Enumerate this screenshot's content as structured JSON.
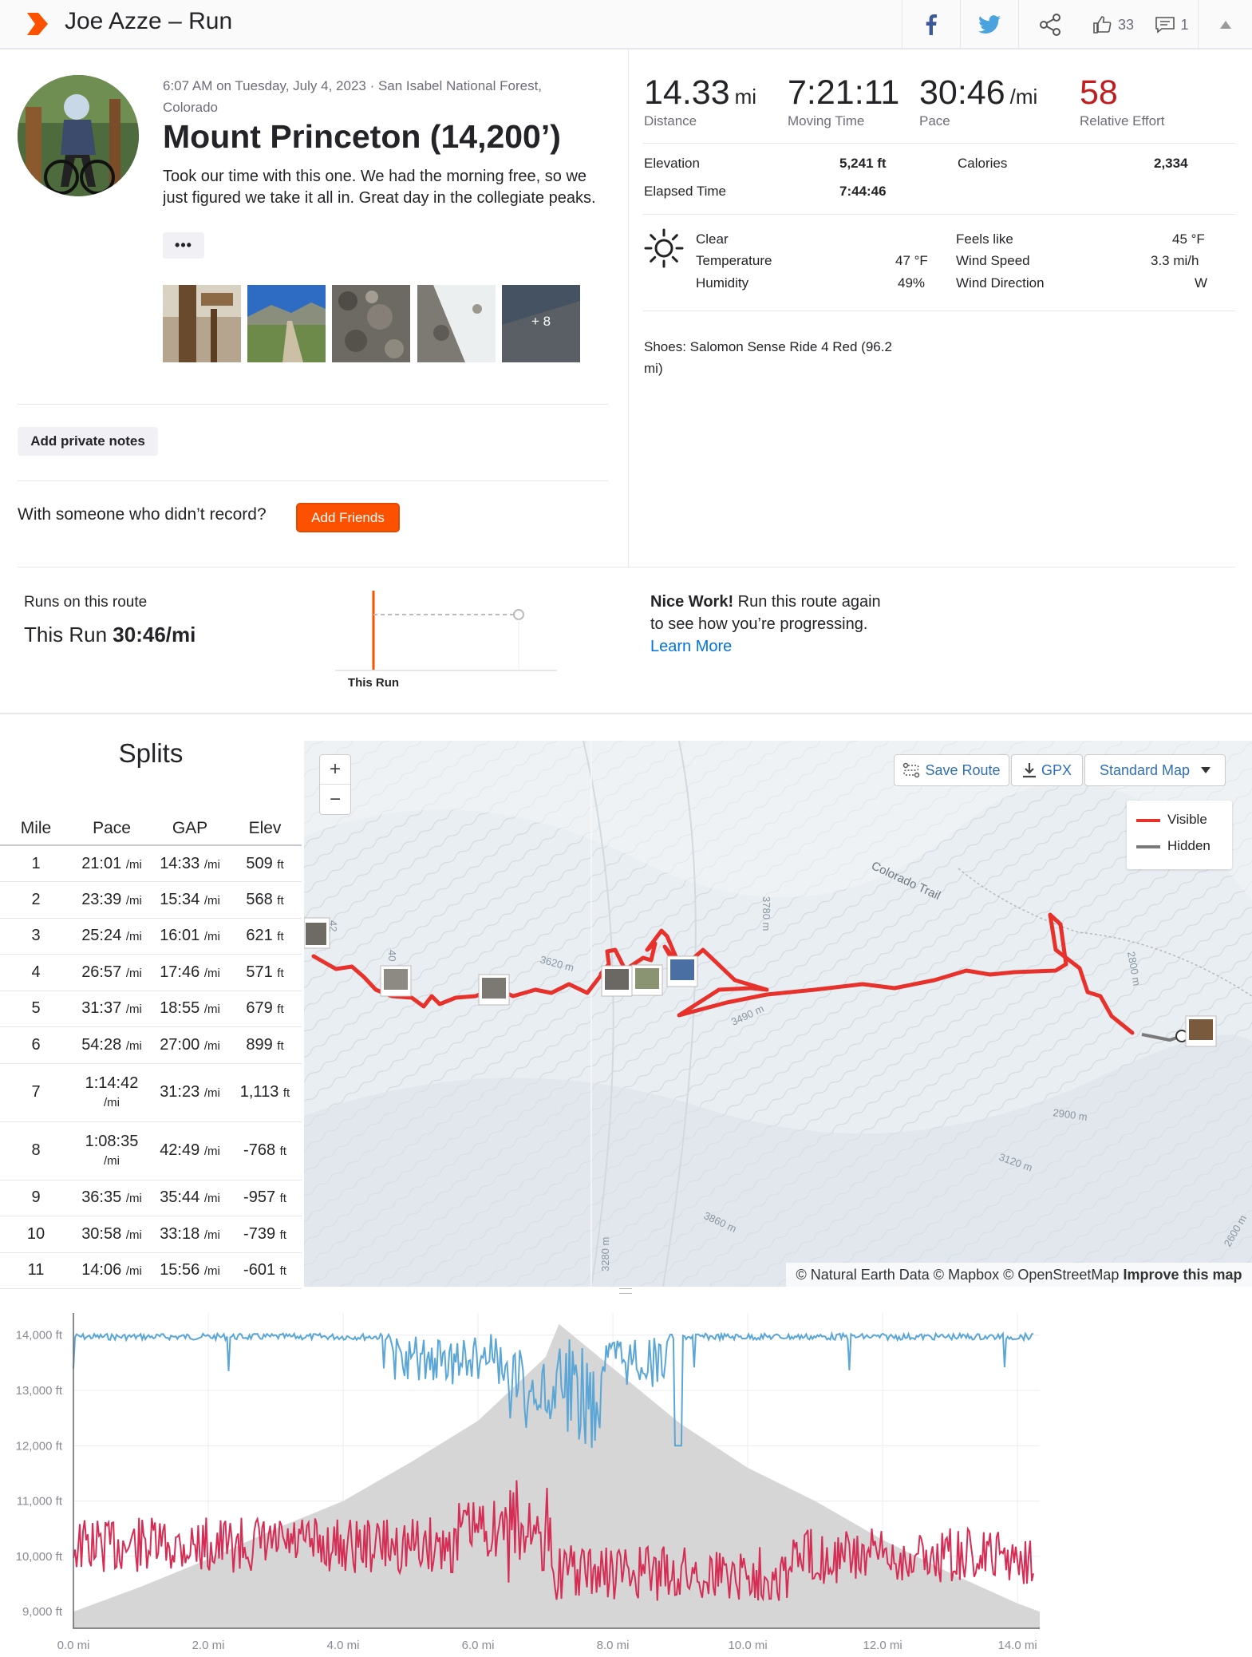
{
  "header": {
    "title": "Joe Azze – Run",
    "kudos_count": "33",
    "comments_count": "1"
  },
  "activity": {
    "meta_line1": "6:07 AM on Tuesday, July 4, 2023 · San Isabel National Forest,",
    "meta_line2": "Colorado",
    "title": "Mount Princeton (14,200’)",
    "description": "Took our time with this one. We had the morning free, so we just figured we take it all in. Great day in the collegiate peaks.",
    "more_label": "•••",
    "photos_more": "+ 8",
    "private_notes_label": "Add private notes",
    "with_someone_text": "With someone who didn’t record?",
    "add_friends_label": "Add Friends"
  },
  "stats": {
    "distance": {
      "value": "14.33",
      "unit": "mi",
      "label": "Distance"
    },
    "moving_time": {
      "value": "7:21:11",
      "label": "Moving Time"
    },
    "pace": {
      "value": "30:46",
      "unit": "/mi",
      "label": "Pace"
    },
    "relative_effort": {
      "value": "58",
      "label": "Relative Effort"
    },
    "elevation": {
      "label": "Elevation",
      "value": "5,241 ft"
    },
    "calories": {
      "label": "Calories",
      "value": "2,334"
    },
    "elapsed_time": {
      "label": "Elapsed Time",
      "value": "7:44:46"
    }
  },
  "weather": {
    "condition": "Clear",
    "temperature_label": "Temperature",
    "temperature": "47 °F",
    "humidity_label": "Humidity",
    "humidity": "49%",
    "feels_like_label": "Feels like",
    "feels_like": "45 °F",
    "wind_speed_label": "Wind Speed",
    "wind_speed": "3.3 mi/h",
    "wind_direction_label": "Wind Direction",
    "wind_direction": "W"
  },
  "shoes": {
    "line1": "Shoes: Salomon Sense Ride 4 Red (96.2",
    "line2": "mi)"
  },
  "route": {
    "label": "Runs on this route",
    "prefix": "This Run",
    "pace": "30:46/mi",
    "chart_label": "This Run",
    "nice_bold": "Nice Work!",
    "nice_text1": " Run this route again",
    "nice_text2": "to see how you’re progressing.",
    "learn_more": "Learn More"
  },
  "splits": {
    "title": "Splits",
    "headers": [
      "Mile",
      "Pace",
      "GAP",
      "Elev"
    ],
    "unit_pace": "/mi",
    "unit_elev": "ft",
    "rows": [
      {
        "mile": "1",
        "pace": "21:01",
        "gap": "14:33",
        "elev": "509"
      },
      {
        "mile": "2",
        "pace": "23:39",
        "gap": "15:34",
        "elev": "568"
      },
      {
        "mile": "3",
        "pace": "25:24",
        "gap": "16:01",
        "elev": "621"
      },
      {
        "mile": "4",
        "pace": "26:57",
        "gap": "17:46",
        "elev": "571"
      },
      {
        "mile": "5",
        "pace": "31:37",
        "gap": "18:55",
        "elev": "679"
      },
      {
        "mile": "6",
        "pace": "54:28",
        "gap": "27:00",
        "elev": "899"
      },
      {
        "mile": "7",
        "pace": "1:14:42",
        "gap": "31:23",
        "elev": "1,113"
      },
      {
        "mile": "8",
        "pace": "1:08:35",
        "gap": "42:49",
        "elev": "-768"
      },
      {
        "mile": "9",
        "pace": "36:35",
        "gap": "35:44",
        "elev": "-957"
      },
      {
        "mile": "10",
        "pace": "30:58",
        "gap": "33:18",
        "elev": "-739"
      },
      {
        "mile": "11",
        "pace": "14:06",
        "gap": "15:56",
        "elev": "-601"
      }
    ]
  },
  "map": {
    "zoom_in": "+",
    "zoom_out": "−",
    "save_route": "Save Route",
    "gpx": "GPX",
    "map_style": "Standard Map",
    "legend_visible": "Visible",
    "legend_hidden": "Hidden",
    "credit_text": "© Natural Earth Data © Mapbox © OpenStreetMap",
    "credit_improve": "Improve this map",
    "labels": {
      "colorado_trail": "Colorado Trail",
      "c3620": "3620 m",
      "c3780": "3780 m",
      "c3490": "3490 m",
      "c2900": "2900 m",
      "c3120": "3120 m",
      "c3860": "3860 m",
      "c3280": "3280 m",
      "c2800": "2800 m",
      "c2600": "2600 m",
      "c42": "42",
      "c40": "40"
    },
    "route_color": "#e8312b",
    "hidden_color": "#7a7a7a"
  },
  "chart_data": {
    "type": "area",
    "x_ticks": [
      "0.0 mi",
      "2.0 mi",
      "4.0 mi",
      "6.0 mi",
      "8.0 mi",
      "10.0 mi",
      "12.0 mi",
      "14.0 mi"
    ],
    "y_ticks": [
      "9,000 ft",
      "10,000 ft",
      "11,000 ft",
      "12,000 ft",
      "13,000 ft",
      "14,000 ft"
    ],
    "xlim": [
      0,
      14.33
    ],
    "ylim": [
      8700,
      14400
    ],
    "elevation": {
      "x": [
        0,
        1,
        2,
        3,
        4,
        5,
        6,
        7,
        7.2,
        8,
        9,
        10,
        11,
        12,
        13,
        14,
        14.33
      ],
      "y": [
        9000,
        9450,
        9950,
        10500,
        11000,
        11700,
        12450,
        13600,
        14200,
        13400,
        12400,
        11600,
        11000,
        10300,
        9700,
        9150,
        9000
      ]
    },
    "pace_series_color": "#5aa6d6",
    "hr_series_color": "#d62d55",
    "elevation_color": "#d6d6d6"
  }
}
